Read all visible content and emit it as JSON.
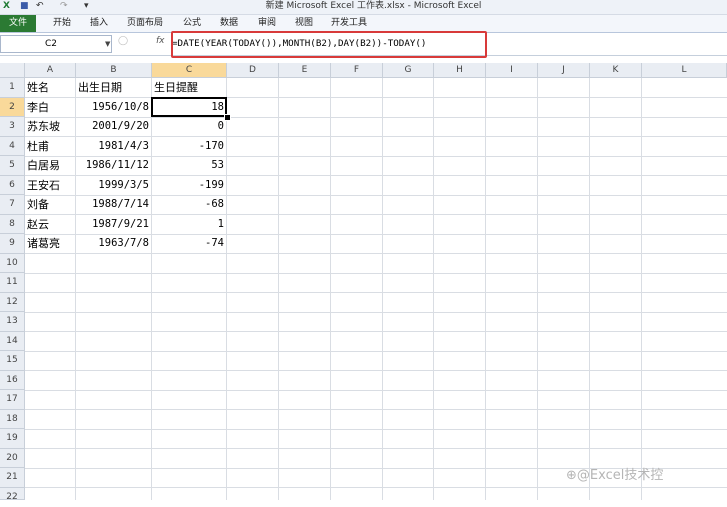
{
  "window": {
    "title": "新建 Microsoft Excel 工作表.xlsx - Microsoft Excel"
  },
  "qat": {
    "icons": [
      "excel-icon",
      "save-icon",
      "undo-icon",
      "redo-icon",
      "customize-icon"
    ]
  },
  "ribbon": {
    "tabs": [
      "文件",
      "开始",
      "插入",
      "页面布局",
      "公式",
      "数据",
      "审阅",
      "视图",
      "开发工具"
    ]
  },
  "formula_bar": {
    "name_box": "C2",
    "fx_label": "fx",
    "formula": "=DATE(YEAR(TODAY()),MONTH(B2),DAY(B2))-TODAY()"
  },
  "sheet": {
    "columns": [
      "A",
      "B",
      "C",
      "D",
      "E",
      "F",
      "G",
      "H",
      "I",
      "J",
      "K",
      "L"
    ],
    "rows": [
      "1",
      "2",
      "3",
      "4",
      "5",
      "6",
      "7",
      "8",
      "9",
      "10",
      "11",
      "12",
      "13",
      "14",
      "15",
      "16",
      "17",
      "18",
      "19",
      "20",
      "21",
      "22"
    ],
    "headers": [
      "姓名",
      "出生日期",
      "生日提醒"
    ],
    "data": [
      [
        "李白",
        "1956/10/8",
        "18"
      ],
      [
        "苏东坡",
        "2001/9/20",
        "0"
      ],
      [
        "杜甫",
        "1981/4/3",
        "-170"
      ],
      [
        "白居易",
        "1986/11/12",
        "53"
      ],
      [
        "王安石",
        "1999/3/5",
        "-199"
      ],
      [
        "刘备",
        "1988/7/14",
        "-68"
      ],
      [
        "赵云",
        "1987/9/21",
        "1"
      ],
      [
        "诸葛亮",
        "1963/7/8",
        "-74"
      ]
    ],
    "selected_cell": "C2"
  },
  "watermark": "⊕@Excel技术控"
}
